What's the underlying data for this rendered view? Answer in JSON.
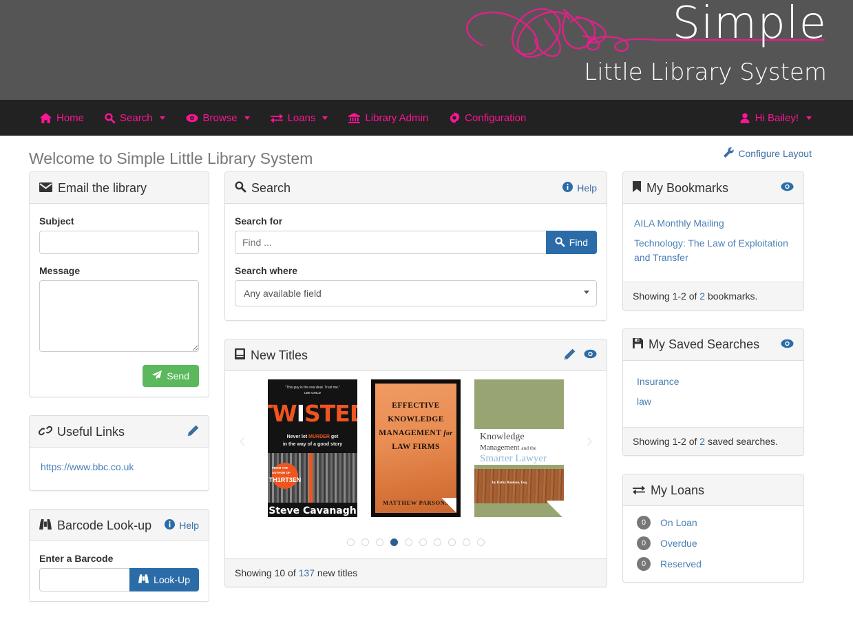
{
  "banner": {
    "brand_top": "Simple",
    "brand_bottom": "Little Library System",
    "logo_icon": "pink-squiggle-logo",
    "bg_color": "#555555",
    "accent_color": "#ff1493"
  },
  "nav": {
    "bg_color": "#222222",
    "link_color": "#ff1493",
    "items": [
      {
        "label": "Home",
        "icon": "home-icon",
        "caret": false
      },
      {
        "label": "Search",
        "icon": "search-icon",
        "caret": true
      },
      {
        "label": "Browse",
        "icon": "eye-icon",
        "caret": true
      },
      {
        "label": "Loans",
        "icon": "exchange-icon",
        "caret": true
      },
      {
        "label": "Library Admin",
        "icon": "bank-icon",
        "caret": false
      },
      {
        "label": "Configuration",
        "icon": "gear-icon",
        "caret": false
      }
    ],
    "user": {
      "label": "Hi Bailey!",
      "icon": "user-icon",
      "caret": true
    }
  },
  "page": {
    "title": "Welcome to Simple Little Library System",
    "configure_layout": {
      "label": "Configure Layout",
      "icon": "wrench-icon"
    }
  },
  "email_panel": {
    "title": "Email the library",
    "icon": "envelope-icon",
    "subject_label": "Subject",
    "subject_value": "",
    "subject_placeholder": "",
    "message_label": "Message",
    "message_value": "",
    "message_placeholder": "",
    "send_label": "Send",
    "send_icon": "paper-plane-icon",
    "send_color": "#5cb85c"
  },
  "useful_links_panel": {
    "title": "Useful Links",
    "icon": "chain-icon",
    "edit_icon": "pencil-icon",
    "links": [
      "https://www.bbc.co.uk"
    ]
  },
  "barcode_panel": {
    "title": "Barcode Look-up",
    "icon": "binoculars-icon",
    "help_label": "Help",
    "help_icon": "info-icon",
    "field_label": "Enter a Barcode",
    "field_value": "",
    "field_placeholder": "",
    "button_label": "Look-Up",
    "button_icon": "binoculars-icon",
    "button_color": "#2b6ca8"
  },
  "search_panel": {
    "title": "Search",
    "icon": "search-icon",
    "help_label": "Help",
    "help_icon": "info-icon",
    "search_for_label": "Search for",
    "search_for_value": "",
    "search_for_placeholder": "Find ...",
    "find_label": "Find",
    "find_icon": "search-icon",
    "search_where_label": "Search where",
    "search_where_selected": "Any available field",
    "search_where_options": [
      "Any available field"
    ]
  },
  "new_titles_panel": {
    "title": "New Titles",
    "icon": "book-icon",
    "edit_icon": "pencil-icon",
    "view_icon": "eye-icon",
    "prev_icon": "chevron-left-icon",
    "next_icon": "chevron-right-icon",
    "dots_total": 10,
    "dot_active_index": 3,
    "footer_prefix": "Showing 10 of ",
    "footer_count": "137",
    "footer_suffix": " new titles",
    "covers": [
      {
        "name": "twisted",
        "quote": "\"This guy is the real deal. Trust me.\"",
        "quote_source": "LEE CHILD",
        "title": "TWISTED",
        "tagline_1": "Never let MURDER get",
        "tagline_2": "in the way of a good story",
        "badge_line_1": "FROM THE AUTHOR OF",
        "badge_line_2": "TH1RT3EN",
        "author": "Steve Cavanagh"
      },
      {
        "name": "effective-knowledge-management",
        "line_1": "Effective",
        "line_2": "Knowledge",
        "line_3": "Management",
        "line_3b": "for",
        "line_4": "Law Firms",
        "author": "Matthew Parsons"
      },
      {
        "name": "knowledge-management-smarter-lawyer",
        "line_1": "Knowledge",
        "line_2": "Management",
        "line_2b": "and the",
        "line_3": "Smarter Lawyer",
        "author": "by Kathy Bauman, Esq."
      }
    ]
  },
  "bookmarks_panel": {
    "title": "My Bookmarks",
    "icon": "bookmark-icon",
    "view_icon": "eye-icon",
    "items": [
      "AILA Monthly Mailing",
      "Technology: The Law of Exploitation and Transfer"
    ],
    "footer_prefix": "Showing 1-2 of ",
    "footer_count": "2",
    "footer_suffix": " bookmarks."
  },
  "saved_searches_panel": {
    "title": "My Saved Searches",
    "icon": "save-icon",
    "view_icon": "eye-icon",
    "items": [
      "Insurance",
      "law"
    ],
    "footer_prefix": "Showing 1-2 of ",
    "footer_count": "2",
    "footer_suffix": " saved searches."
  },
  "loans_panel": {
    "title": "My Loans",
    "icon": "exchange-icon",
    "rows": [
      {
        "count": "0",
        "label": "On Loan"
      },
      {
        "count": "0",
        "label": "Overdue"
      },
      {
        "count": "0",
        "label": "Reserved"
      }
    ]
  }
}
